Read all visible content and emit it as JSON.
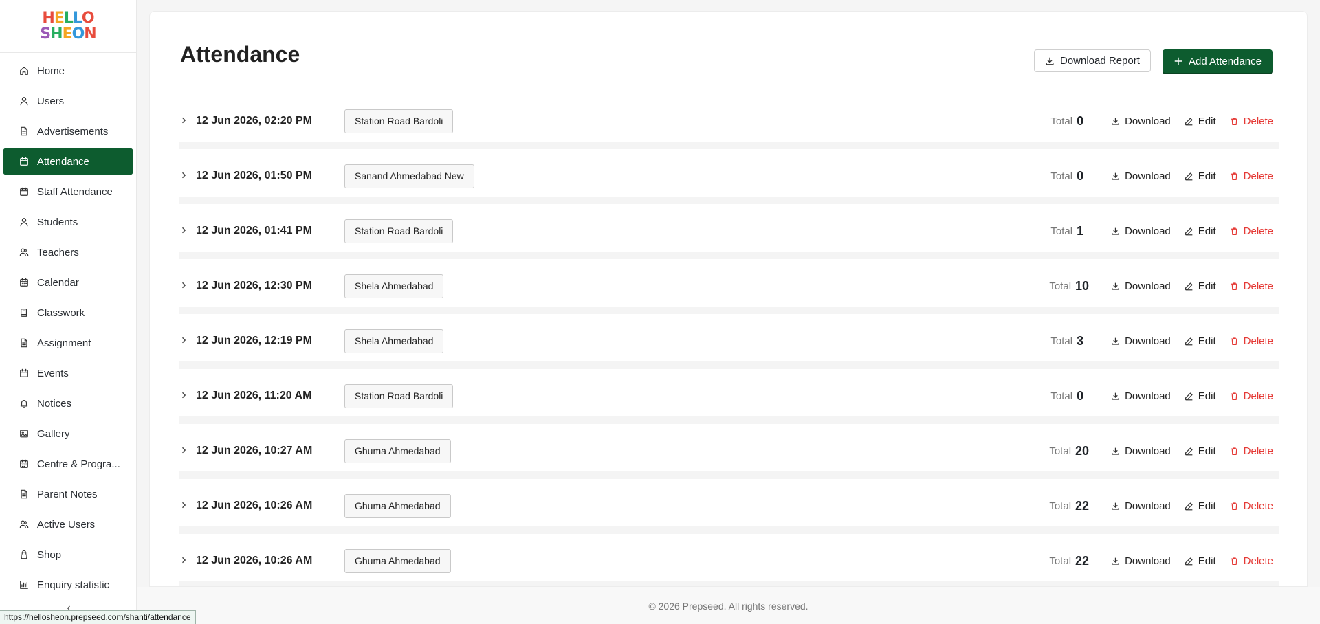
{
  "brand": {
    "logo_line1": "HELLO",
    "logo_line2": "SHEON"
  },
  "sidebar": {
    "items": [
      {
        "label": "Home",
        "icon": "home-icon"
      },
      {
        "label": "Users",
        "icon": "user-icon"
      },
      {
        "label": "Advertisements",
        "icon": "document-icon"
      },
      {
        "label": "Attendance",
        "icon": "calendar-icon",
        "active": true
      },
      {
        "label": "Staff Attendance",
        "icon": "calendar-icon"
      },
      {
        "label": "Students",
        "icon": "user-icon"
      },
      {
        "label": "Teachers",
        "icon": "users-icon"
      },
      {
        "label": "Calendar",
        "icon": "calendar-grid-icon"
      },
      {
        "label": "Classwork",
        "icon": "book-icon"
      },
      {
        "label": "Assignment",
        "icon": "document-icon"
      },
      {
        "label": "Events",
        "icon": "calendar-icon"
      },
      {
        "label": "Notices",
        "icon": "bell-icon"
      },
      {
        "label": "Gallery",
        "icon": "image-icon"
      },
      {
        "label": "Centre & Progra...",
        "icon": "calendar-grid-icon"
      },
      {
        "label": "Parent Notes",
        "icon": "document-icon"
      },
      {
        "label": "Active Users",
        "icon": "users-icon"
      },
      {
        "label": "Shop",
        "icon": "bag-icon"
      },
      {
        "label": "Enquiry statistic",
        "icon": "chart-icon"
      }
    ],
    "collapse_glyph": "‹"
  },
  "header": {
    "title": "Attendance",
    "download_report_label": "Download Report",
    "add_attendance_label": "Add Attendance"
  },
  "labels": {
    "total": "Total",
    "download": "Download",
    "edit": "Edit",
    "delete": "Delete"
  },
  "attendance_rows": [
    {
      "datetime": "12 Jun 2026, 02:20 PM",
      "centre": "Station Road Bardoli",
      "total": "0"
    },
    {
      "datetime": "12 Jun 2026, 01:50 PM",
      "centre": "Sanand Ahmedabad New",
      "total": "0"
    },
    {
      "datetime": "12 Jun 2026, 01:41 PM",
      "centre": "Station Road Bardoli",
      "total": "1"
    },
    {
      "datetime": "12 Jun 2026, 12:30 PM",
      "centre": "Shela Ahmedabad",
      "total": "10"
    },
    {
      "datetime": "12 Jun 2026, 12:19 PM",
      "centre": "Shela Ahmedabad",
      "total": "3"
    },
    {
      "datetime": "12 Jun 2026, 11:20 AM",
      "centre": "Station Road Bardoli",
      "total": "0"
    },
    {
      "datetime": "12 Jun 2026, 10:27 AM",
      "centre": "Ghuma Ahmedabad",
      "total": "20"
    },
    {
      "datetime": "12 Jun 2026, 10:26 AM",
      "centre": "Ghuma Ahmedabad",
      "total": "22"
    },
    {
      "datetime": "12 Jun 2026, 10:26 AM",
      "centre": "Ghuma Ahmedabad",
      "total": "22"
    }
  ],
  "footer": {
    "text": "© 2026 Prepseed. All rights reserved."
  },
  "status_bar": {
    "url": "https://hellosheon.prepseed.com/shanti/attendance"
  },
  "colors": {
    "primary": "#0d5c2f",
    "danger": "#e53935"
  }
}
